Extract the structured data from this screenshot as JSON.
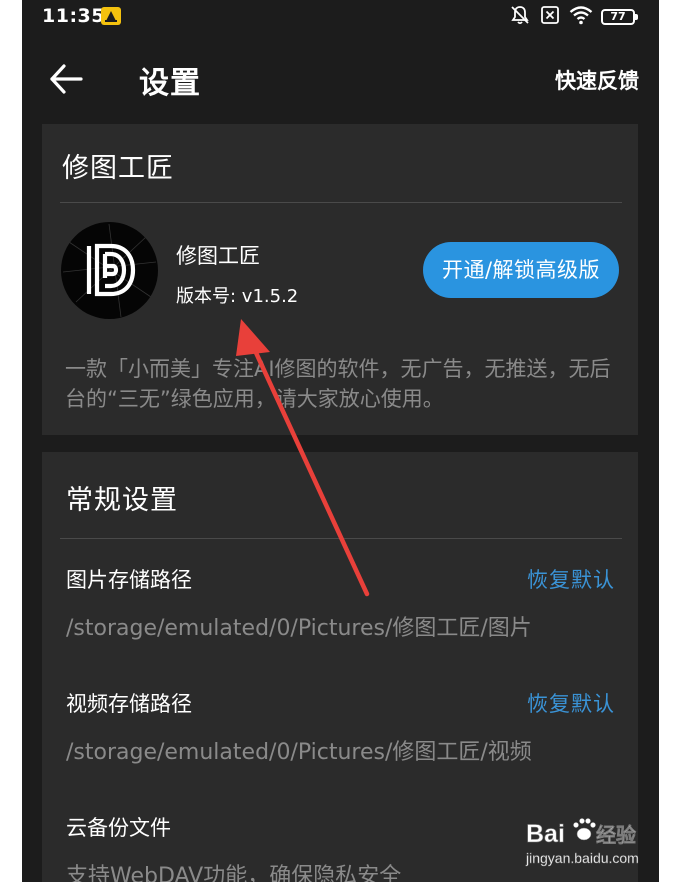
{
  "status_bar": {
    "time": "11:35",
    "battery": "77"
  },
  "header": {
    "title": "设置",
    "feedback": "快速反馈"
  },
  "app_card": {
    "title": "修图工匠",
    "app_name": "修图工匠",
    "version": "版本号: v1.5.2",
    "unlock_button": "开通/解锁高级版",
    "description": "一款「小而美」专注AI修图的软件，无广告，无推送，无后台的“三无”绿色应用，请大家放心使用。"
  },
  "general_card": {
    "title": "常规设置",
    "items": [
      {
        "label": "图片存储路径",
        "value": "/storage/emulated/0/Pictures/修图工匠/图片",
        "action": "恢复默认"
      },
      {
        "label": "视频存储路径",
        "value": "/storage/emulated/0/Pictures/修图工匠/视频",
        "action": "恢复默认"
      },
      {
        "label": "云备份文件",
        "value": "支持WebDAV功能，确保隐私安全"
      }
    ]
  },
  "watermark": {
    "brand": "Bai",
    "brand_suffix": "经验",
    "url": "jingyan.baidu.com"
  },
  "colors": {
    "background": "#1c1c1c",
    "card": "#2b2b2b",
    "accent": "#2a94e0",
    "link": "#3a93d6",
    "muted_text": "#8a8a8a",
    "arrow": "#e8403a"
  }
}
